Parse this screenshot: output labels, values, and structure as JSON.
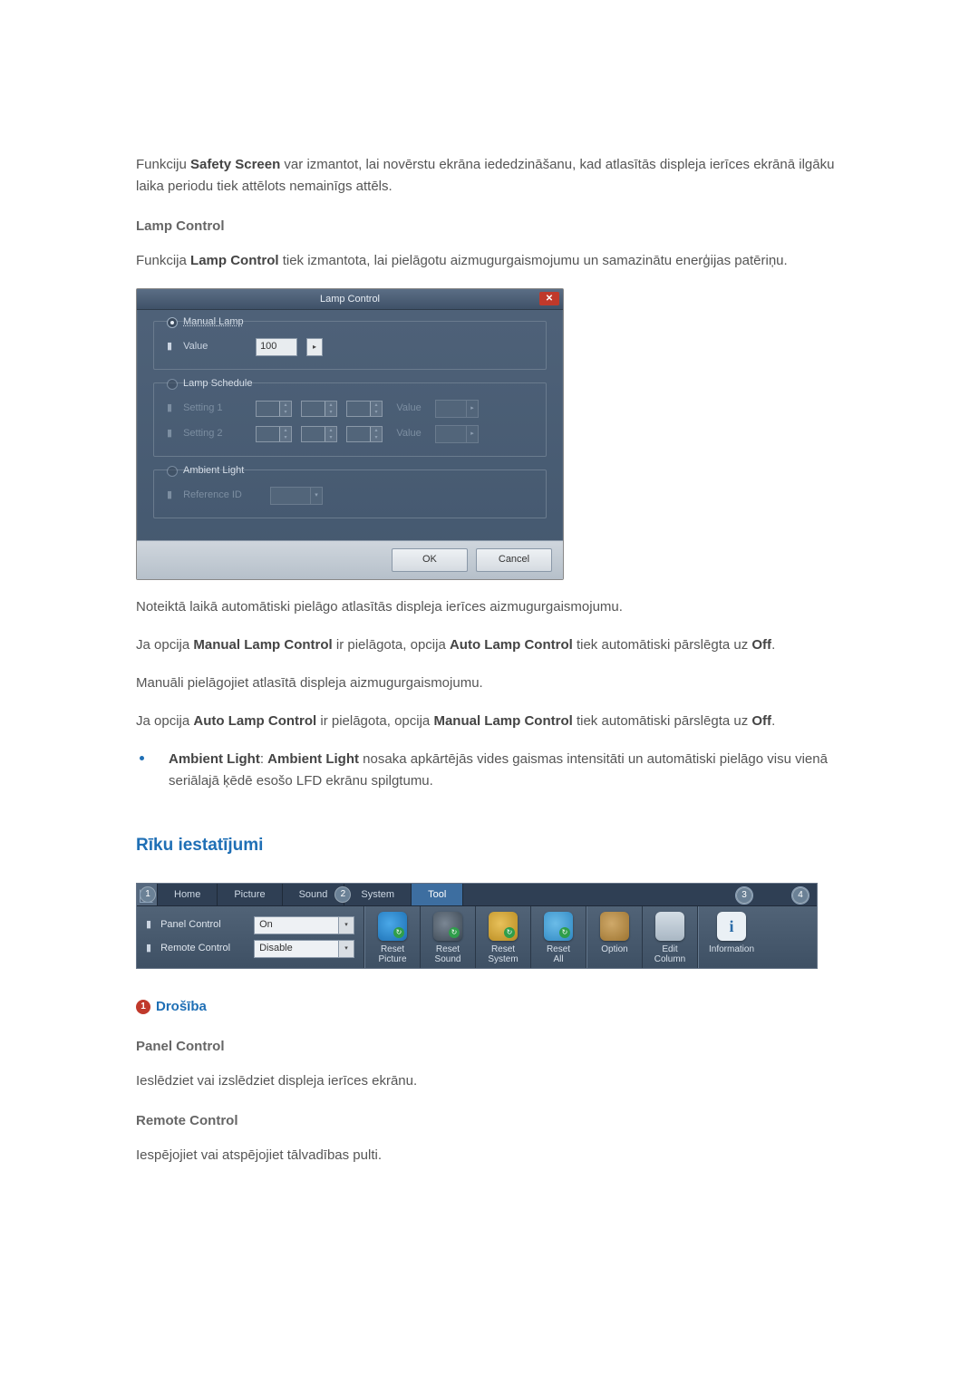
{
  "intro": {
    "safetyScreen": {
      "pre": "Funkciju ",
      "bold": "Safety Screen",
      "post": " var izmantot, lai novērstu ekrāna iededzināšanu, kad atlasītās displeja ierīces ekrānā ilgāku laika periodu tiek attēlots nemainīgs attēls."
    },
    "lampHeading": "Lamp Control",
    "lampPara": {
      "pre": "Funkcija ",
      "bold": "Lamp Control",
      "post": " tiek izmantota, lai pielāgotu aizmugurgaismojumu un samazinātu enerģijas patēriņu."
    }
  },
  "dialog": {
    "title": "Lamp Control",
    "manualLamp": {
      "legend": "Manual Lamp",
      "valueLabel": "Value",
      "value": "100"
    },
    "schedule": {
      "legend": "Lamp Schedule",
      "row1": "Setting 1",
      "row2": "Setting 2",
      "valueLabel": "Value"
    },
    "ambient": {
      "legend": "Ambient Light",
      "refLabel": "Reference ID"
    },
    "ok": "OK",
    "cancel": "Cancel"
  },
  "afterDialog": {
    "line1": "Noteiktā laikā automātiski pielāgo atlasītās displeja ierīces aizmugurgaismojumu.",
    "manualAuto": {
      "pre": "Ja opcija ",
      "b1": "Manual Lamp Control",
      "mid": " ir pielāgota, opcija ",
      "b2": "Auto Lamp Control",
      "post": " tiek automātiski pārslēgta uz ",
      "off": "Off",
      "dot": "."
    },
    "line3": "Manuāli pielāgojiet atlasītā displeja aizmugurgaismojumu.",
    "autoManual": {
      "pre": "Ja opcija ",
      "b1": "Auto Lamp Control",
      "mid": " ir pielāgota, opcija ",
      "b2": "Manual Lamp Control",
      "post": " tiek automātiski pārslēgta uz ",
      "off": "Off",
      "dot": "."
    },
    "ambientBullet": {
      "b1": "Ambient Light",
      "sep": ": ",
      "b2": "Ambient Light",
      "post": " nosaka apkārtējās vides gaismas intensitāti un automātiski pielāgo visu vienā seriālajā ķēdē esošo LFD ekrānu spilgtumu."
    }
  },
  "toolSettings": {
    "heading": "Rīku iestatījumi",
    "callout1": "1",
    "callout2": "2",
    "callout3": "3",
    "callout4": "4",
    "tabs": {
      "home": "Home",
      "picture": "Picture",
      "sound": "Sound",
      "system": "System",
      "tool": "Tool"
    },
    "panel": {
      "panelControl": "Panel Control",
      "panelValue": "On",
      "remoteControl": "Remote Control",
      "remoteValue": "Disable"
    },
    "icons": {
      "resetPicture": "Reset\nPicture",
      "resetSound": "Reset\nSound",
      "resetSystem": "Reset\nSystem",
      "resetAll": "Reset\nAll",
      "option": "Option",
      "editColumn": "Edit\nColumn",
      "information": "Information"
    }
  },
  "security": {
    "badge": "1",
    "heading": "Drošība",
    "panelControl": "Panel Control",
    "panelText": "Ieslēdziet vai izslēdziet displeja ierīces ekrānu.",
    "remoteControl": "Remote Control",
    "remoteText": "Iespējojiet vai atspējojiet tālvadības pulti."
  }
}
